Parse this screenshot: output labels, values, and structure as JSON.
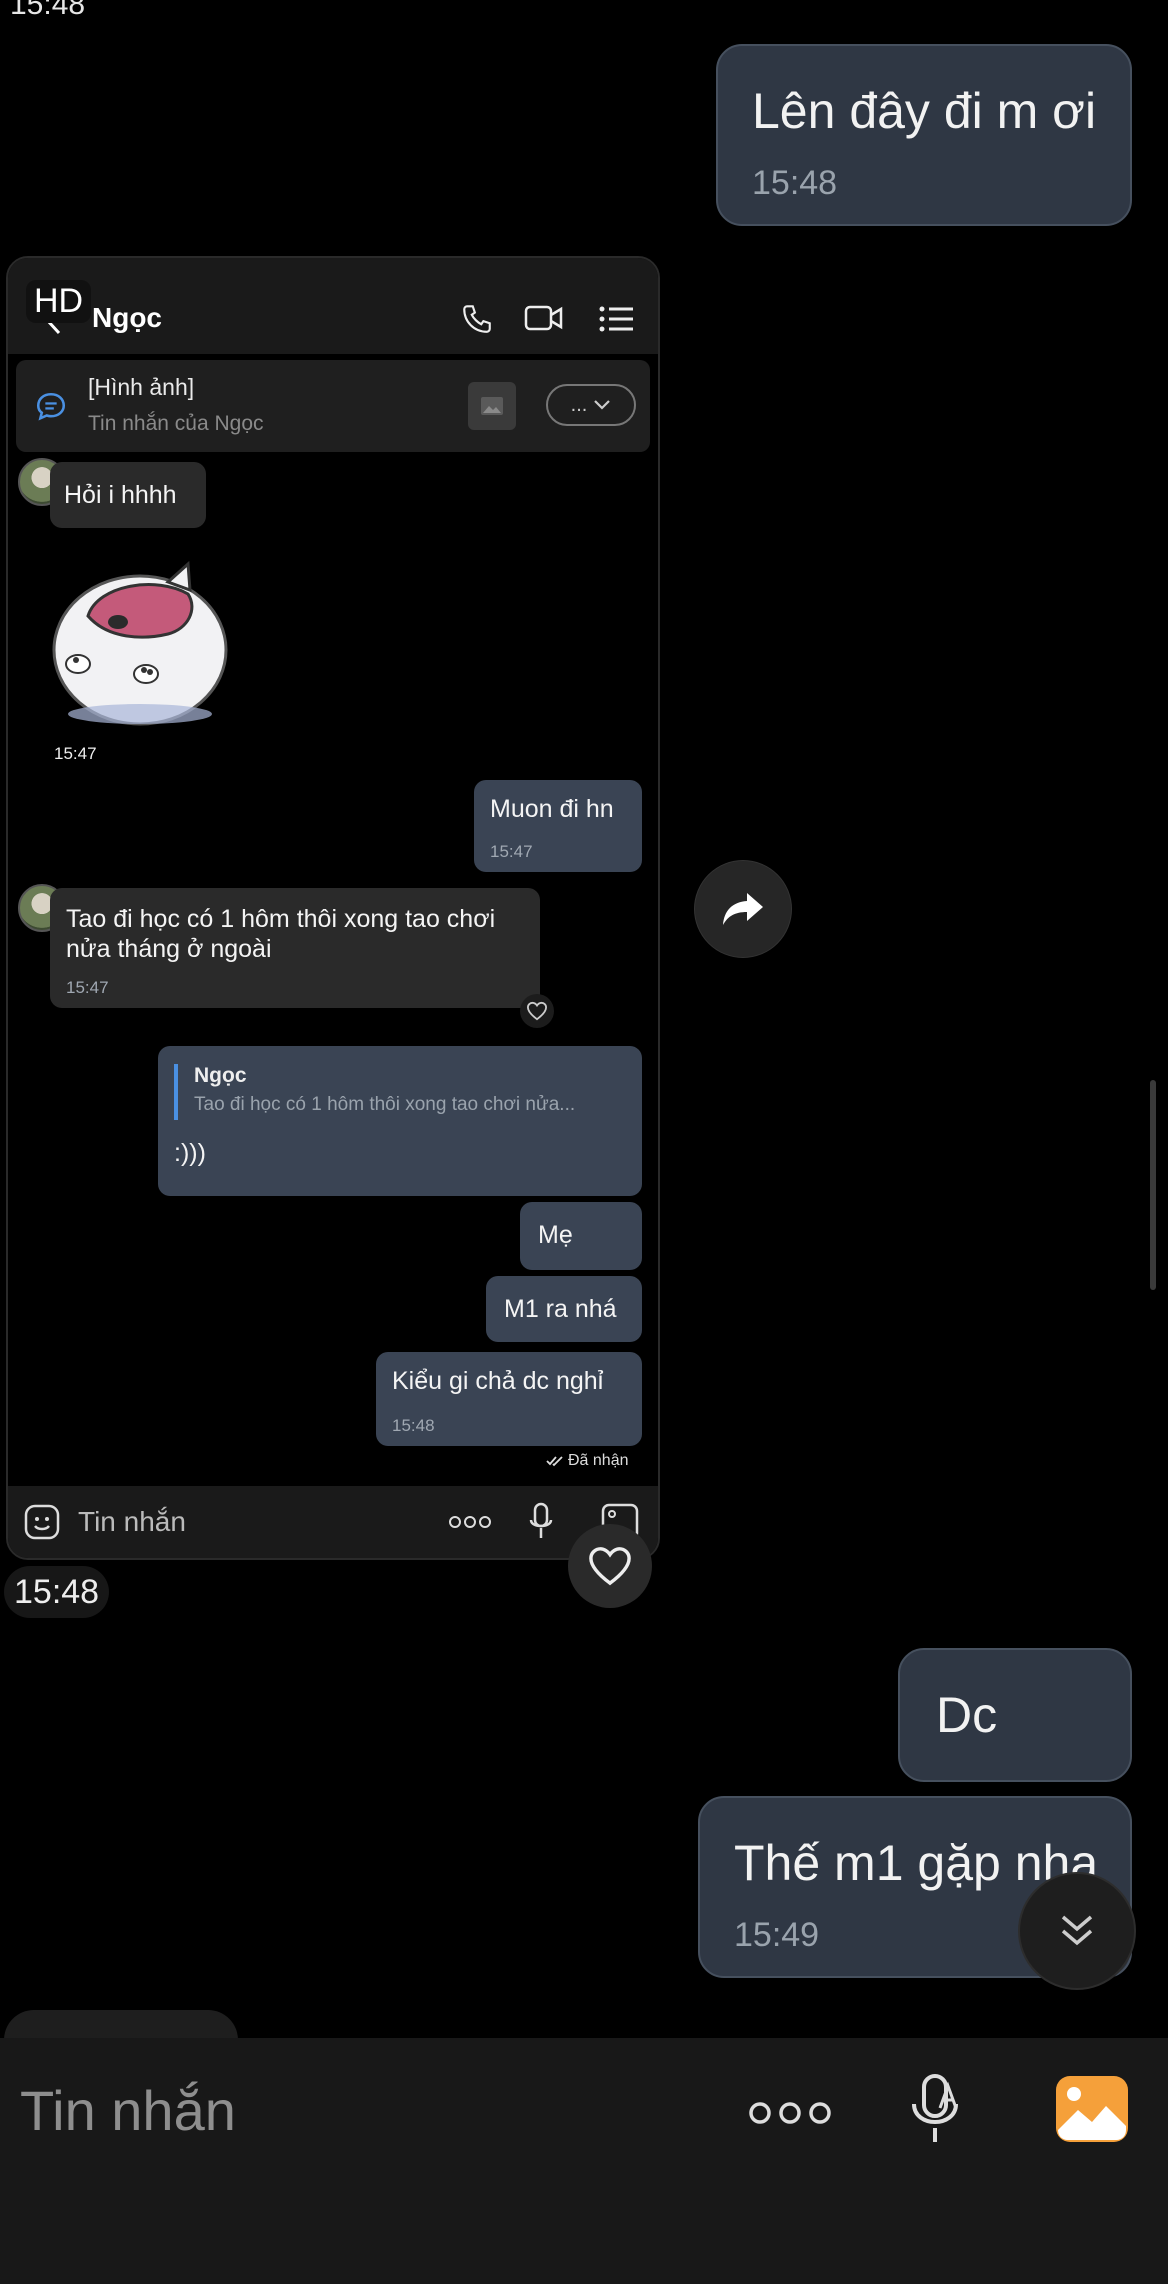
{
  "outer": {
    "top_time": "15:48",
    "messages": [
      {
        "text": "Lên đây đi m ơi",
        "time": "15:48"
      },
      {
        "text": "Dc",
        "time": ""
      },
      {
        "text": "Thế m1 gặp nha",
        "time": "15:49"
      }
    ],
    "date_time_label": "15:48",
    "input_placeholder": "Tin nhắn"
  },
  "inner": {
    "hd_badge": "HD",
    "contact_name": "Ngọc",
    "pinned": {
      "title": "[Hình ảnh]",
      "subtitle": "Tin nhắn của Ngọc",
      "more_label": "..."
    },
    "messages": [
      {
        "text": "Hỏi i hhhh"
      },
      {
        "sticker_time": "15:47"
      },
      {
        "text": "Muon đi hn",
        "time": "15:47"
      },
      {
        "text": "Tao đi học có 1 hôm thôi xong tao chơi nửa tháng ở ngoài",
        "time": "15:47"
      },
      {
        "quote_name": "Ngọc",
        "quote_text": "Tao đi học có 1 hôm thôi xong tao chơi nửa...",
        "text": ":)))"
      },
      {
        "text": "Mẹ"
      },
      {
        "text": "M1 ra nhá"
      },
      {
        "text": "Kiểu gi chả dc nghỉ",
        "time": "15:48"
      }
    ],
    "status": "Đã nhận",
    "input_placeholder": "Tin nhắn"
  },
  "colors": {
    "background": "#000000",
    "outgoing_bubble": "#2f3744",
    "incoming_bubble": "#2a2a2a",
    "gallery_icon": "#f5a03a"
  }
}
